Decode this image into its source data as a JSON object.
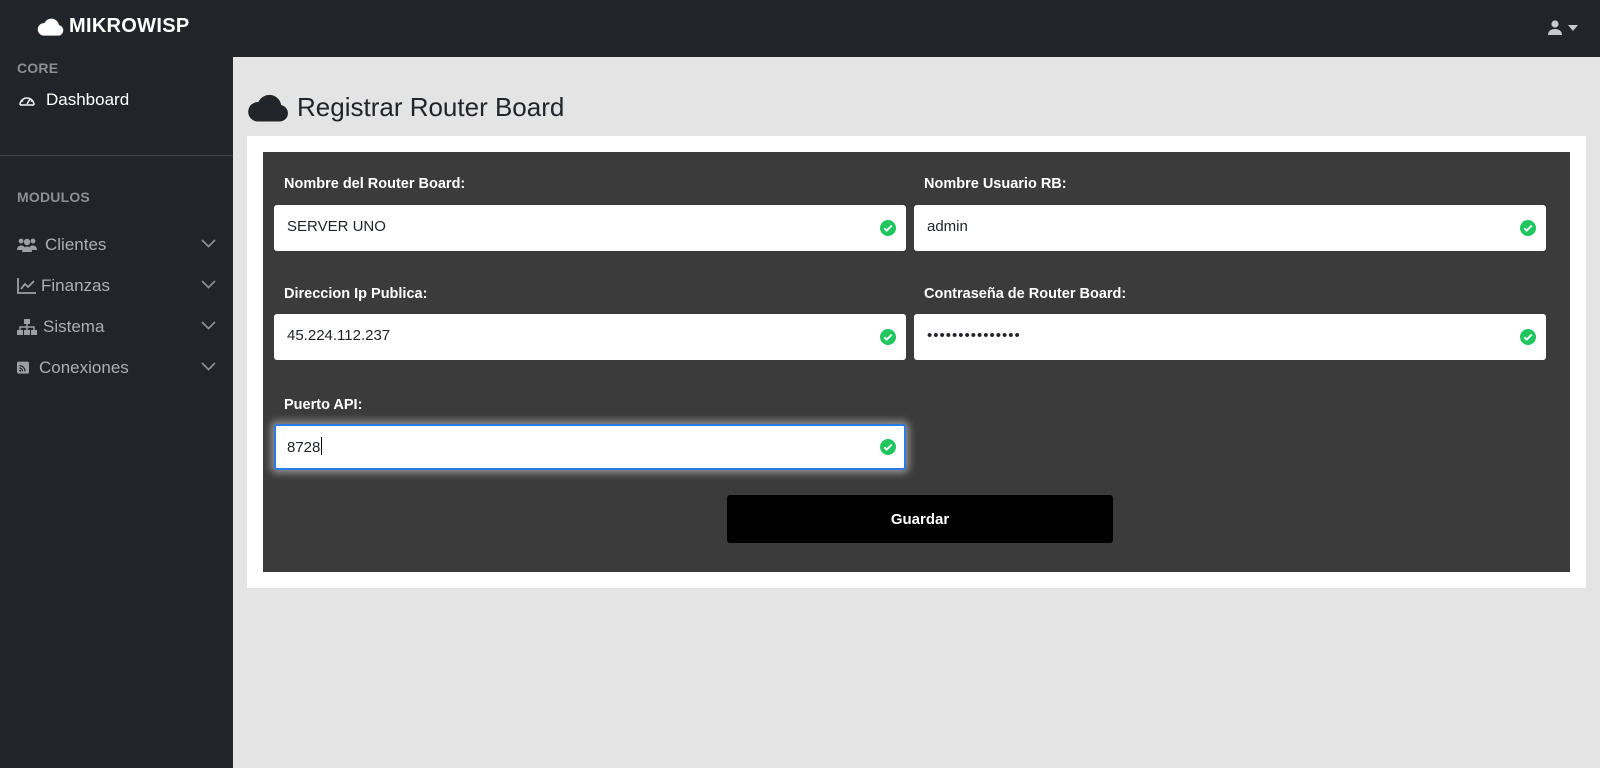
{
  "brand": {
    "name": "MIKROWISP",
    "icon": "cloud-icon"
  },
  "topbar": {
    "user_icon": "user-icon",
    "dropdown_icon": "caret-down-icon"
  },
  "sidebar": {
    "core_heading": "CORE",
    "dashboard": {
      "label": "Dashboard",
      "icon": "tachometer-icon"
    },
    "modules_heading": "MODULOS",
    "items": [
      {
        "label": "Clientes",
        "icon": "users-icon"
      },
      {
        "label": "Finanzas",
        "icon": "chart-line-icon"
      },
      {
        "label": "Sistema",
        "icon": "sitemap-icon"
      },
      {
        "label": "Conexiones",
        "icon": "rss-square-icon"
      }
    ]
  },
  "page": {
    "title": "Registrar Router Board",
    "icon": "cloud-icon"
  },
  "form": {
    "router_name": {
      "label": "Nombre del Router Board:",
      "value": "SERVER UNO"
    },
    "rb_user": {
      "label": "Nombre Usuario RB:",
      "value": "admin"
    },
    "public_ip": {
      "label": "Direccion Ip Publica:",
      "value": "45.224.112.237"
    },
    "rb_password": {
      "label": "Contraseña de Router Board:",
      "value": "•••••••••••••••"
    },
    "api_port": {
      "label": "Puerto API:",
      "value": "8728"
    },
    "save_label": "Guardar"
  },
  "colors": {
    "navbar": "#212529",
    "panel": "#3b3b3b",
    "valid": "#22c55e",
    "focus": "#2a7be4",
    "button": "#000000"
  }
}
